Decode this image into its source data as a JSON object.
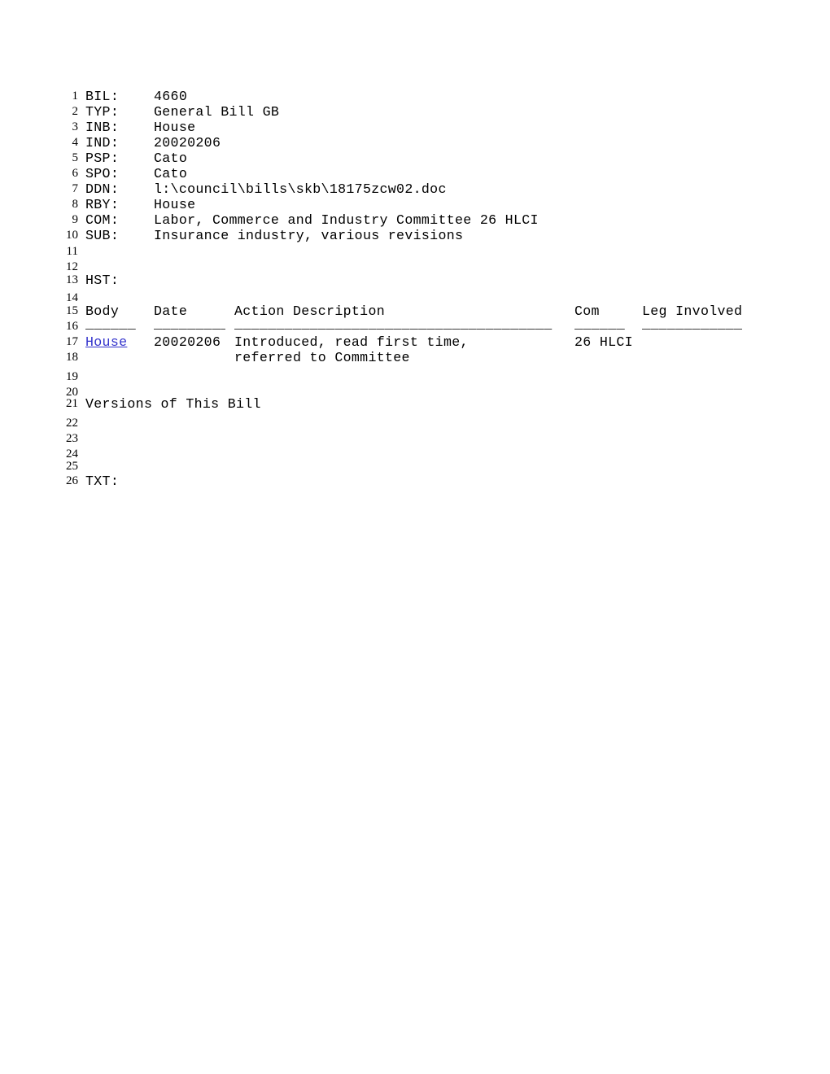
{
  "document": {
    "type": "legislative-bill-record",
    "line_numbers": [
      1,
      2,
      3,
      4,
      5,
      6,
      7,
      8,
      9,
      10,
      11,
      12,
      13,
      14,
      15,
      16,
      17,
      18,
      19,
      20,
      21,
      22,
      23,
      24,
      25,
      26
    ],
    "fields": [
      {
        "line": 1,
        "label": "BIL:",
        "value": "4660"
      },
      {
        "line": 2,
        "label": "TYP:",
        "value": "General Bill GB"
      },
      {
        "line": 3,
        "label": "INB:",
        "value": "House"
      },
      {
        "line": 4,
        "label": "IND:",
        "value": "20020206"
      },
      {
        "line": 5,
        "label": "PSP:",
        "value": "Cato"
      },
      {
        "line": 6,
        "label": "SPO:",
        "value": "Cato"
      },
      {
        "line": 7,
        "label": "DDN:",
        "value": "l:\\council\\bills\\skb\\18175zcw02.doc"
      },
      {
        "line": 8,
        "label": "RBY:",
        "value": "House"
      },
      {
        "line": 9,
        "label": "COM:",
        "value": "Labor, Commerce and Industry Committee 26 HLCI"
      },
      {
        "line": 10,
        "label": "SUB:",
        "value": "Insurance industry, various revisions"
      }
    ],
    "history_heading": "HST:",
    "history_table": {
      "columns": [
        "Body",
        "Date",
        "Action Description",
        "Com",
        "Leg Involved"
      ],
      "rows": [
        {
          "body": "House",
          "body_is_link": true,
          "date": "20020206",
          "action_line1": "Introduced, read first time,",
          "action_line2": "referred to Committee",
          "com": "26 HLCI",
          "leg_involved": ""
        }
      ]
    },
    "versions_heading": "Versions of This Bill",
    "text_heading": "TXT:"
  },
  "colors": {
    "page_background": "#ffffff",
    "text": "#000000",
    "link": "#3333cc"
  }
}
